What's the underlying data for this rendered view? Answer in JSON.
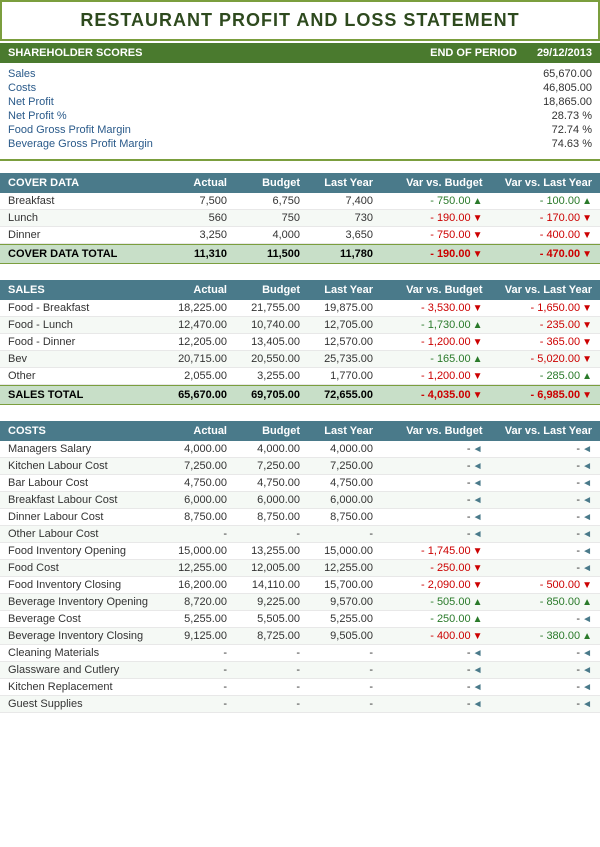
{
  "title": "RESTAURANT PROFIT AND LOSS STATEMENT",
  "shareholder": {
    "label": "SHAREHOLDER SCORES",
    "end_of_period": "END OF PERIOD",
    "date": "29/12/2013"
  },
  "summary": {
    "rows": [
      {
        "label": "Sales",
        "value": "65,670.00"
      },
      {
        "label": "Costs",
        "value": "46,805.00"
      },
      {
        "label": "Net Profit",
        "value": "18,865.00"
      },
      {
        "label": "Net Profit %",
        "value": "28.73 %"
      },
      {
        "label": "Food Gross Profit Margin",
        "value": "72.74 %"
      },
      {
        "label": "Beverage Gross Profit Margin",
        "value": "74.63 %"
      }
    ]
  },
  "cover_data": {
    "header": "COVER DATA",
    "cols": [
      "Actual",
      "Budget",
      "Last Year",
      "Var vs. Budget",
      "Var vs. Last Year"
    ],
    "rows": [
      {
        "label": "Breakfast",
        "actual": "7,500",
        "budget": "6,750",
        "last_year": "7,400",
        "var_budget": "750.00",
        "var_budget_dir": "up",
        "var_ly": "100.00",
        "var_ly_dir": "up"
      },
      {
        "label": "Lunch",
        "actual": "560",
        "budget": "750",
        "last_year": "730",
        "var_budget": "190.00",
        "var_budget_dir": "down",
        "var_ly": "170.00",
        "var_ly_dir": "down"
      },
      {
        "label": "Dinner",
        "actual": "3,250",
        "budget": "4,000",
        "last_year": "3,650",
        "var_budget": "750.00",
        "var_budget_dir": "down",
        "var_ly": "400.00",
        "var_ly_dir": "down"
      }
    ],
    "total": {
      "label": "COVER DATA TOTAL",
      "actual": "11,310",
      "budget": "11,500",
      "last_year": "11,780",
      "var_budget": "190.00",
      "var_budget_dir": "down",
      "var_ly": "470.00",
      "var_ly_dir": "down"
    }
  },
  "sales": {
    "header": "SALES",
    "cols": [
      "Actual",
      "Budget",
      "Last Year",
      "Var vs. Budget",
      "Var vs. Last Year"
    ],
    "rows": [
      {
        "label": "Food - Breakfast",
        "actual": "18,225.00",
        "budget": "21,755.00",
        "last_year": "19,875.00",
        "var_budget": "3,530.00",
        "var_budget_dir": "down",
        "var_ly": "1,650.00",
        "var_ly_dir": "down"
      },
      {
        "label": "Food - Lunch",
        "actual": "12,470.00",
        "budget": "10,740.00",
        "last_year": "12,705.00",
        "var_budget": "1,730.00",
        "var_budget_dir": "up",
        "var_ly": "235.00",
        "var_ly_dir": "down"
      },
      {
        "label": "Food - Dinner",
        "actual": "12,205.00",
        "budget": "13,405.00",
        "last_year": "12,570.00",
        "var_budget": "1,200.00",
        "var_budget_dir": "down",
        "var_ly": "365.00",
        "var_ly_dir": "down"
      },
      {
        "label": "Bev",
        "actual": "20,715.00",
        "budget": "20,550.00",
        "last_year": "25,735.00",
        "var_budget": "165.00",
        "var_budget_dir": "up",
        "var_ly": "5,020.00",
        "var_ly_dir": "down"
      },
      {
        "label": "Other",
        "actual": "2,055.00",
        "budget": "3,255.00",
        "last_year": "1,770.00",
        "var_budget": "1,200.00",
        "var_budget_dir": "down",
        "var_ly": "285.00",
        "var_ly_dir": "up"
      }
    ],
    "total": {
      "label": "SALES TOTAL",
      "actual": "65,670.00",
      "budget": "69,705.00",
      "last_year": "72,655.00",
      "var_budget": "4,035.00",
      "var_budget_dir": "down",
      "var_ly": "6,985.00",
      "var_ly_dir": "down"
    }
  },
  "costs": {
    "header": "COSTS",
    "cols": [
      "Actual",
      "Budget",
      "Last Year",
      "Var vs. Budget",
      "Var vs. Last Year"
    ],
    "rows": [
      {
        "label": "Managers Salary",
        "actual": "4,000.00",
        "budget": "4,000.00",
        "last_year": "4,000.00",
        "var_budget": "-",
        "var_budget_dir": "neutral",
        "var_ly": "-",
        "var_ly_dir": "neutral"
      },
      {
        "label": "Kitchen Labour Cost",
        "actual": "7,250.00",
        "budget": "7,250.00",
        "last_year": "7,250.00",
        "var_budget": "-",
        "var_budget_dir": "neutral",
        "var_ly": "-",
        "var_ly_dir": "neutral"
      },
      {
        "label": "Bar Labour Cost",
        "actual": "4,750.00",
        "budget": "4,750.00",
        "last_year": "4,750.00",
        "var_budget": "-",
        "var_budget_dir": "neutral",
        "var_ly": "-",
        "var_ly_dir": "neutral"
      },
      {
        "label": "Breakfast Labour Cost",
        "actual": "6,000.00",
        "budget": "6,000.00",
        "last_year": "6,000.00",
        "var_budget": "-",
        "var_budget_dir": "neutral",
        "var_ly": "-",
        "var_ly_dir": "neutral"
      },
      {
        "label": "Dinner Labour Cost",
        "actual": "8,750.00",
        "budget": "8,750.00",
        "last_year": "8,750.00",
        "var_budget": "-",
        "var_budget_dir": "neutral",
        "var_ly": "-",
        "var_ly_dir": "neutral"
      },
      {
        "label": "Other Labour Cost",
        "actual": "-",
        "budget": "-",
        "last_year": "-",
        "var_budget": "-",
        "var_budget_dir": "neutral",
        "var_ly": "-",
        "var_ly_dir": "neutral"
      },
      {
        "label": "Food Inventory Opening",
        "actual": "15,000.00",
        "budget": "13,255.00",
        "last_year": "15,000.00",
        "var_budget": "1,745.00",
        "var_budget_dir": "down",
        "var_ly": "-",
        "var_ly_dir": "neutral"
      },
      {
        "label": "Food Cost",
        "actual": "12,255.00",
        "budget": "12,005.00",
        "last_year": "12,255.00",
        "var_budget": "250.00",
        "var_budget_dir": "down",
        "var_ly": "-",
        "var_ly_dir": "neutral"
      },
      {
        "label": "Food Inventory Closing",
        "actual": "16,200.00",
        "budget": "14,110.00",
        "last_year": "15,700.00",
        "var_budget": "2,090.00",
        "var_budget_dir": "down",
        "var_ly": "500.00",
        "var_ly_dir": "down"
      },
      {
        "label": "Beverage Inventory Opening",
        "actual": "8,720.00",
        "budget": "9,225.00",
        "last_year": "9,570.00",
        "var_budget": "505.00",
        "var_budget_dir": "up",
        "var_ly": "850.00",
        "var_ly_dir": "up"
      },
      {
        "label": "Beverage Cost",
        "actual": "5,255.00",
        "budget": "5,505.00",
        "last_year": "5,255.00",
        "var_budget": "250.00",
        "var_budget_dir": "up",
        "var_ly": "-",
        "var_ly_dir": "neutral"
      },
      {
        "label": "Beverage Inventory Closing",
        "actual": "9,125.00",
        "budget": "8,725.00",
        "last_year": "9,505.00",
        "var_budget": "400.00",
        "var_budget_dir": "down",
        "var_ly": "380.00",
        "var_ly_dir": "up"
      },
      {
        "label": "Cleaning Materials",
        "actual": "-",
        "budget": "-",
        "last_year": "-",
        "var_budget": "-",
        "var_budget_dir": "neutral",
        "var_ly": "-",
        "var_ly_dir": "neutral"
      },
      {
        "label": "Glassware and Cutlery",
        "actual": "-",
        "budget": "-",
        "last_year": "-",
        "var_budget": "-",
        "var_budget_dir": "neutral",
        "var_ly": "-",
        "var_ly_dir": "neutral"
      },
      {
        "label": "Kitchen Replacement",
        "actual": "-",
        "budget": "-",
        "last_year": "-",
        "var_budget": "-",
        "var_budget_dir": "neutral",
        "var_ly": "-",
        "var_ly_dir": "neutral"
      },
      {
        "label": "Guest Supplies",
        "actual": "-",
        "budget": "-",
        "last_year": "-",
        "var_budget": "-",
        "var_budget_dir": "neutral",
        "var_ly": "-",
        "var_ly_dir": "neutral"
      }
    ]
  }
}
